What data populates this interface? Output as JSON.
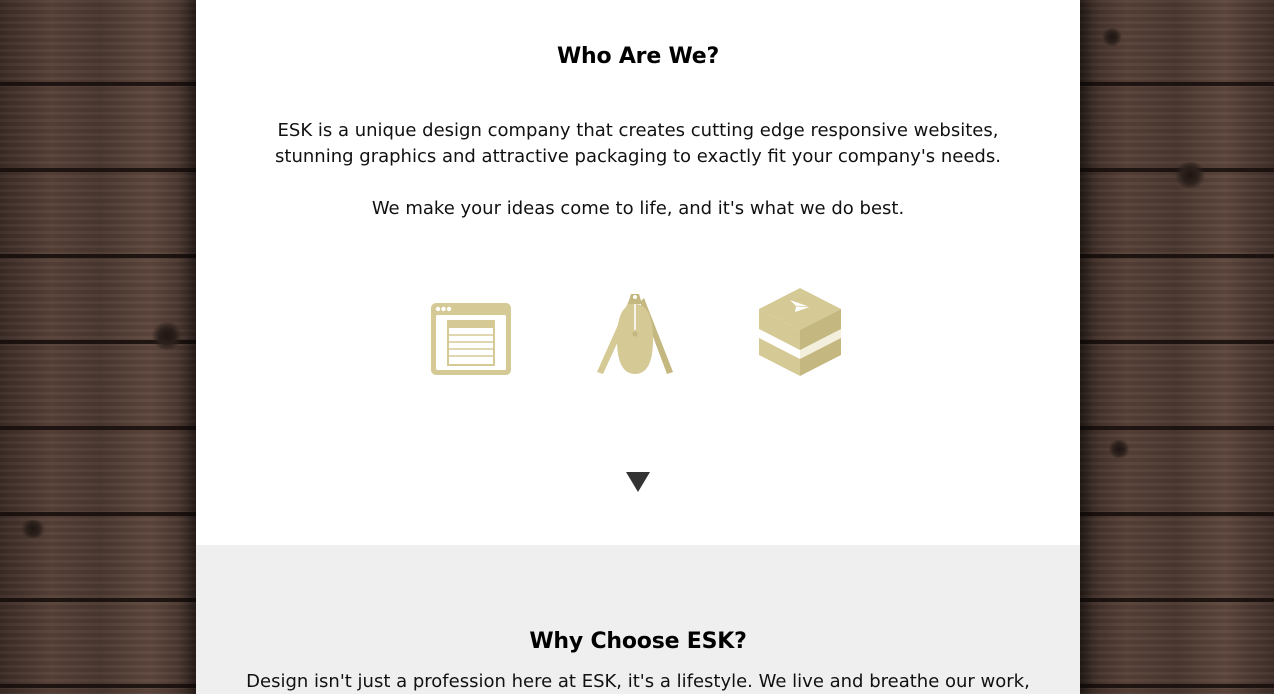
{
  "about": {
    "heading": "Who Are We?",
    "paragraph_1": "ESK is a unique design company that creates cutting edge responsive websites, stunning graphics and attractive packaging to exactly fit your company's needs.",
    "paragraph_2": "We make your ideas come to life, and it's what we do best.",
    "icons": [
      "web-browser-icon",
      "pen-and-mouse-icon",
      "package-box-icon"
    ]
  },
  "why": {
    "heading": "Why Choose ESK?",
    "paragraph": "Design isn't just a profession here at ESK, it's a lifestyle. We live and breathe our work,"
  },
  "colors": {
    "icon_gold": "#d5c995",
    "icon_gold_dark": "#c4b780",
    "arrow": "#333333",
    "bottom_section_bg": "#efefef"
  }
}
